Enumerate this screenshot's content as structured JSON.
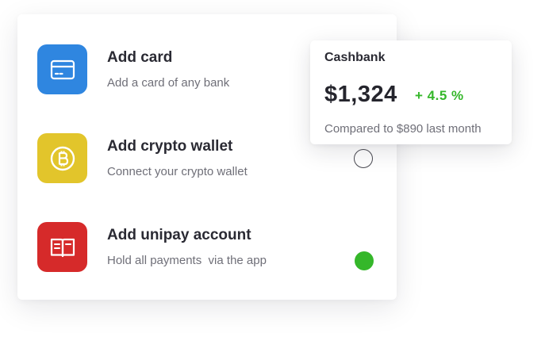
{
  "payment_options": [
    {
      "title": "Add card",
      "subtitle": "Add a card of any bank",
      "icon": "credit-card-icon",
      "icon_color": "#2f86e0"
    },
    {
      "title": "Add crypto wallet",
      "subtitle": "Connect your crypto wallet",
      "icon": "bitcoin-icon",
      "icon_color": "#e2c52b",
      "radio_state": "unselected"
    },
    {
      "title": "Add unipay account",
      "subtitle": "Hold all payments  via the app",
      "icon": "book-icon",
      "icon_color": "#d62a2a",
      "radio_state": "selected"
    }
  ],
  "cashbank": {
    "title": "Cashbank",
    "amount": "$1,324",
    "change": "+ 4.5 %",
    "compare": "Compared to $890 last month"
  },
  "colors": {
    "accent_green": "#35b72a",
    "text_dark": "#2a2a33",
    "text_muted": "#6f6f78"
  }
}
